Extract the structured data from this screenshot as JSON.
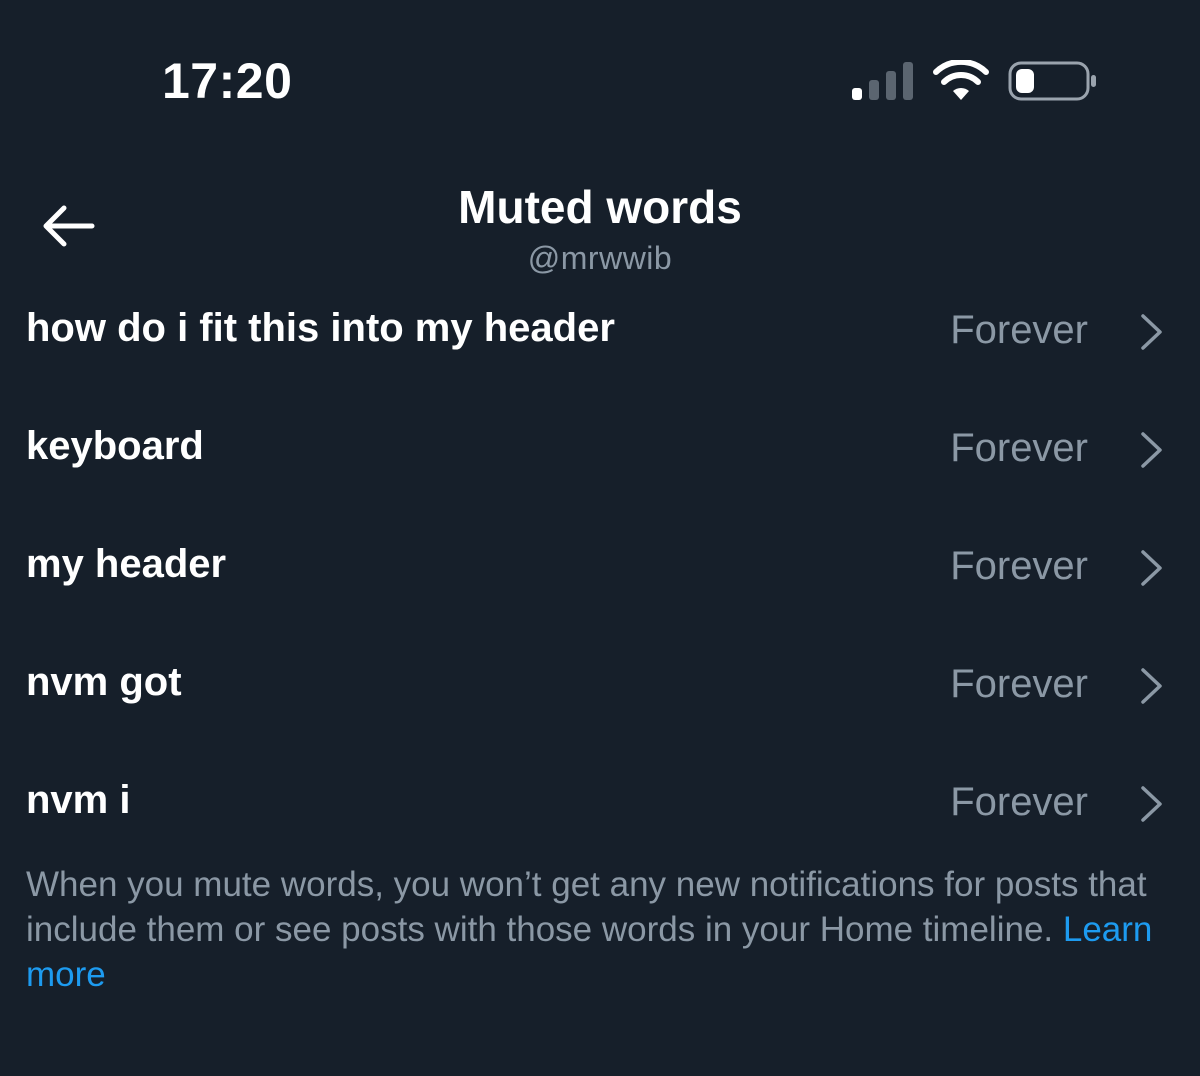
{
  "status_bar": {
    "time": "17:20",
    "icons": [
      "signal-icon",
      "wifi-icon",
      "battery-icon"
    ]
  },
  "header": {
    "back_icon": "back-arrow-icon",
    "title": "Muted words",
    "subtitle": "@mrwwib"
  },
  "muted_words": [
    {
      "word": "how do i fit this into my header",
      "duration": "Forever"
    },
    {
      "word": "keyboard",
      "duration": "Forever"
    },
    {
      "word": "my header",
      "duration": "Forever"
    },
    {
      "word": "nvm got",
      "duration": "Forever"
    },
    {
      "word": "nvm i",
      "duration": "Forever"
    }
  ],
  "footer": {
    "note": "When you mute words, you won’t get any new notifications for posts that include them or see posts with those words in your Home timeline. ",
    "link": "Learn more"
  },
  "colors": {
    "background": "#161f2a",
    "primary_text": "#ffffff",
    "secondary_text": "#8b98a5",
    "link": "#1d9bf0"
  }
}
